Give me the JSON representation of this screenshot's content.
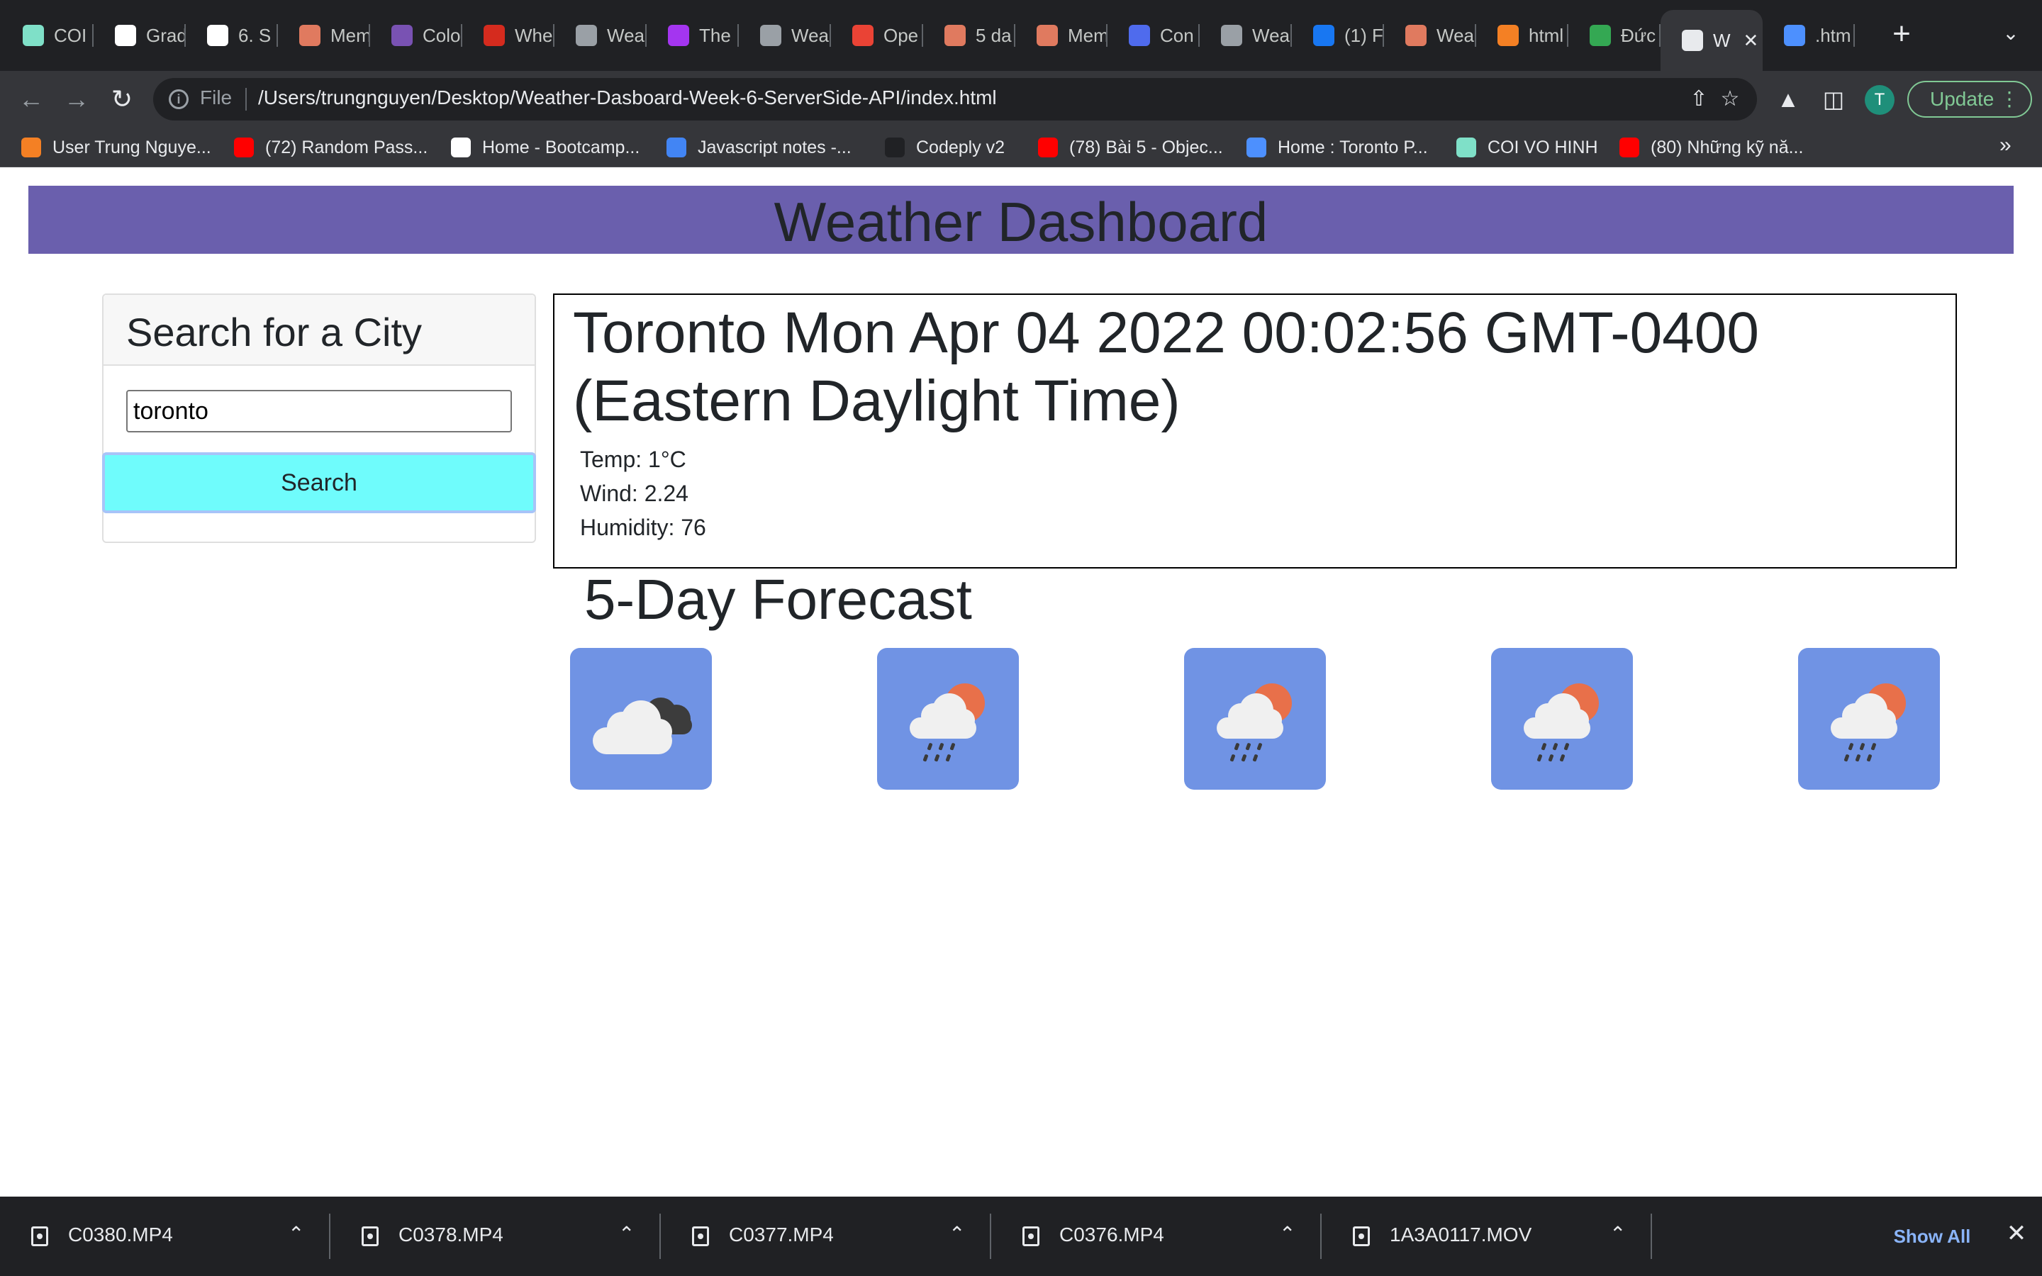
{
  "browser": {
    "tabs": [
      {
        "label": "COI",
        "icon": "tpl-logo-icon",
        "color": "#7fe0c8"
      },
      {
        "label": "Grad",
        "icon": "bootcamp-icon",
        "color": "#ffffff"
      },
      {
        "label": "6. S",
        "icon": "bootcamp-icon",
        "color": "#ffffff"
      },
      {
        "label": "Mem",
        "icon": "helmet-icon",
        "color": "#e07a5f"
      },
      {
        "label": "Colo",
        "icon": "bootstrap-icon",
        "color": "#7952b3"
      },
      {
        "label": "Whe",
        "icon": "maple-leaf-icon",
        "color": "#d52b1e"
      },
      {
        "label": "Wea",
        "icon": "globe-icon",
        "color": "#9aa0a6"
      },
      {
        "label": "The",
        "icon": "udemy-icon",
        "color": "#a435f0"
      },
      {
        "label": "Wea",
        "icon": "globe-icon",
        "color": "#9aa0a6"
      },
      {
        "label": "Ope",
        "icon": "gmail-icon",
        "color": "#ea4335"
      },
      {
        "label": "5 da",
        "icon": "helmet-icon",
        "color": "#e07a5f"
      },
      {
        "label": "Mem",
        "icon": "helmet-icon",
        "color": "#e07a5f"
      },
      {
        "label": "Con",
        "icon": "ring-icon",
        "color": "#4f6bed"
      },
      {
        "label": "Wea",
        "icon": "globe-icon",
        "color": "#9aa0a6"
      },
      {
        "label": "(1) F",
        "icon": "facebook-icon",
        "color": "#1877f2"
      },
      {
        "label": "Wea",
        "icon": "helmet-icon",
        "color": "#e07a5f"
      },
      {
        "label": "html",
        "icon": "stackoverflow-icon",
        "color": "#f48024"
      },
      {
        "label": "Đức",
        "icon": "google-drive-icon",
        "color": "#34a853"
      },
      {
        "label": "W",
        "icon": "globe-icon",
        "color": "#e8eaed"
      },
      {
        "label": ".htm",
        "icon": "loading-icon",
        "color": "#4d90fe"
      }
    ],
    "url_scheme": "File",
    "url": "/Users/trungnguyen/Desktop/Weather-Dasboard-Week-6-ServerSide-API/index.html",
    "profile_initial": "T",
    "update_label": "Update",
    "bookmarks": [
      {
        "label": "User Trung Nguye...",
        "icon": "stackoverflow-icon",
        "color": "#f48024"
      },
      {
        "label": "(72) Random Pass...",
        "icon": "youtube-icon",
        "color": "#ff0000"
      },
      {
        "label": "Home - Bootcamp...",
        "icon": "bootcamp-icon",
        "color": "#ffffff"
      },
      {
        "label": "Javascript notes -...",
        "icon": "docs-icon",
        "color": "#4285f4"
      },
      {
        "label": "Codeply v2",
        "icon": "codeply-icon",
        "color": "#202124"
      },
      {
        "label": "(78) Bài 5 - Objec...",
        "icon": "youtube-icon",
        "color": "#ff0000"
      },
      {
        "label": "Home : Toronto P...",
        "icon": "tpl-icon",
        "color": "#4d90fe"
      },
      {
        "label": "COI VO HINH",
        "icon": "tpl-logo-icon",
        "color": "#7fe0c8"
      },
      {
        "label": "(80) Những kỹ nă...",
        "icon": "youtube-icon",
        "color": "#ff0000"
      }
    ]
  },
  "page": {
    "title": "Weather Dashboard",
    "header_color": "#6a5fad",
    "search": {
      "heading": "Search for a City",
      "input_value": "toronto",
      "button_label": "Search",
      "button_color": "#6ffcfc"
    },
    "current": {
      "title": "Toronto Mon Apr 04 2022 00:02:56 GMT-0400 (Eastern Daylight Time)",
      "temp": "Temp: 1°C",
      "wind": "Wind: 2.24",
      "humidity": "Humidity: 76"
    },
    "forecast": {
      "heading": "5-Day Forecast",
      "days": [
        {
          "icon": "broken-clouds-icon"
        },
        {
          "icon": "rain-sun-icon"
        },
        {
          "icon": "rain-sun-icon"
        },
        {
          "icon": "rain-sun-icon"
        },
        {
          "icon": "rain-sun-icon"
        }
      ]
    }
  },
  "downloads": {
    "items": [
      "C0380.MP4",
      "C0378.MP4",
      "C0377.MP4",
      "C0376.MP4",
      "1A3A0117.MOV"
    ],
    "show_all_label": "Show All"
  }
}
